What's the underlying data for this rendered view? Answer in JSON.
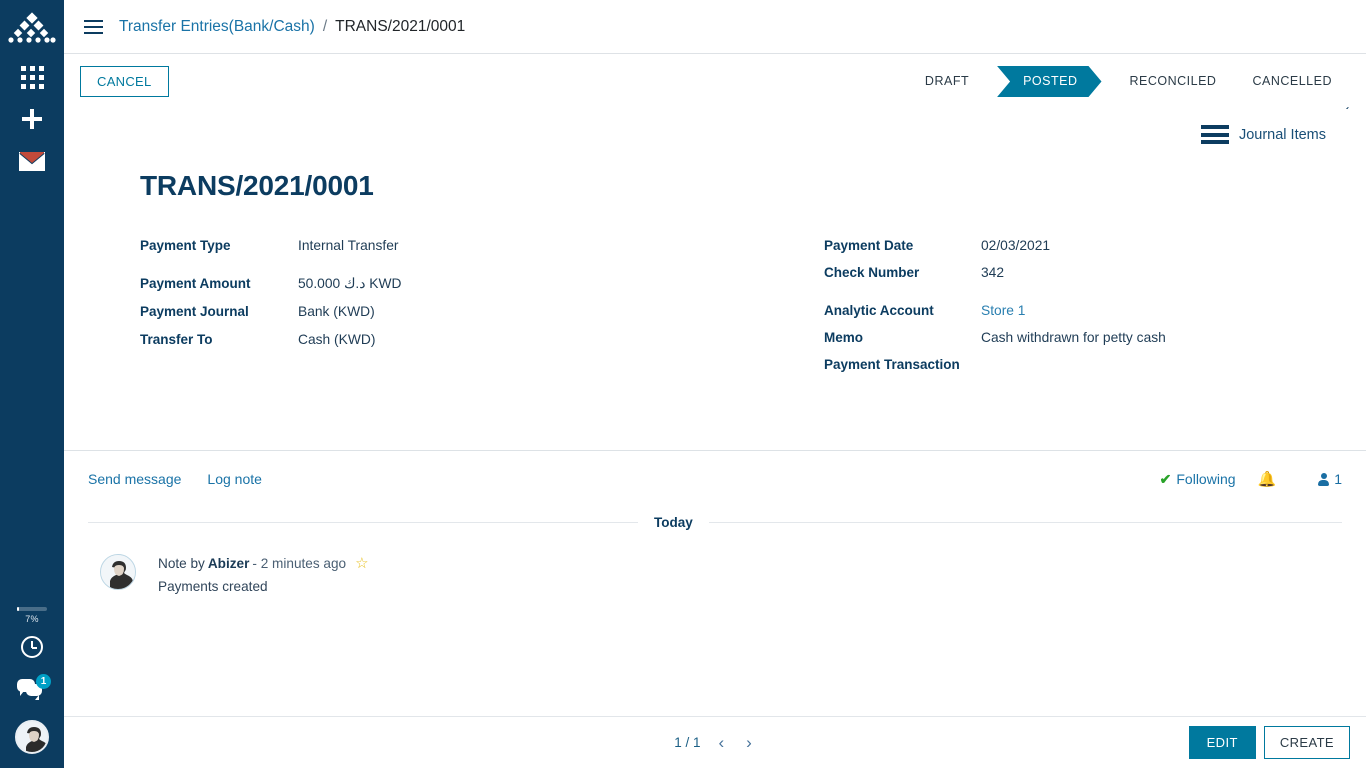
{
  "colors": {
    "sidebar_bg": "#0c3c60",
    "accent_teal": "#00799e",
    "link_blue": "#1a73a7",
    "title_navy": "#0c3c60",
    "check_green": "#29a329",
    "star_yellow": "#e8c020",
    "badge_blue": "#00a0c6"
  },
  "sidebar": {
    "logo_name": "app-logo",
    "items": [
      {
        "name": "apps-grid-icon",
        "label": "Apps"
      },
      {
        "name": "plus-icon",
        "label": "New"
      },
      {
        "name": "envelope-icon",
        "label": "Messages"
      }
    ],
    "bottom": {
      "progress_pct": "7%",
      "progress_value": 7,
      "clock_label": "Activities",
      "chat_label": "Conversations",
      "chat_badge": "1",
      "avatar_label": "User avatar"
    }
  },
  "breadcrumb": {
    "menu_label": "Toggle menu",
    "parent": "Transfer Entries(Bank/Cash)",
    "separator": "/",
    "current": "TRANS/2021/0001"
  },
  "controls": {
    "cancel_label": "CANCEL",
    "collapse_label": "‹",
    "statuses": [
      {
        "label": "DRAFT",
        "active": false
      },
      {
        "label": "POSTED",
        "active": true
      },
      {
        "label": "RECONCILED",
        "active": false
      },
      {
        "label": "CANCELLED",
        "active": false
      }
    ]
  },
  "statbutton": {
    "label": "Journal Items"
  },
  "record": {
    "title": "TRANS/2021/0001",
    "left_fields": [
      {
        "label": "Payment Type",
        "value": "Internal Transfer",
        "link": false
      },
      {
        "label": "Payment Amount",
        "value": "50.000 د.ك KWD",
        "link": false
      },
      {
        "label": "Payment Journal",
        "value": "Bank (KWD)",
        "link": false
      },
      {
        "label": "Transfer To",
        "value": "Cash (KWD)",
        "link": false
      }
    ],
    "right_fields": [
      {
        "label": "Payment Date",
        "value": "02/03/2021",
        "link": false
      },
      {
        "label": "Check Number",
        "value": "342",
        "link": false
      },
      {
        "label": "Analytic Account",
        "value": "Store 1",
        "link": true
      },
      {
        "label": "Memo",
        "value": "Cash withdrawn for petty cash",
        "link": false
      },
      {
        "label": "Payment Transaction",
        "value": "",
        "link": false
      }
    ]
  },
  "chatter": {
    "send_message": "Send message",
    "log_note": "Log note",
    "following_check": "✔",
    "following_label": "Following",
    "bell_glyph": "🔔",
    "followers_count": "1",
    "day_divider": "Today",
    "messages": [
      {
        "prefix": "Note by",
        "author": "Abizer",
        "meta": "- 2 minutes ago",
        "star": "☆",
        "body": "Payments created"
      }
    ]
  },
  "footer": {
    "pager_count": "1 / 1",
    "prev_glyph": "‹",
    "next_glyph": "›",
    "edit_label": "EDIT",
    "create_label": "CREATE"
  }
}
